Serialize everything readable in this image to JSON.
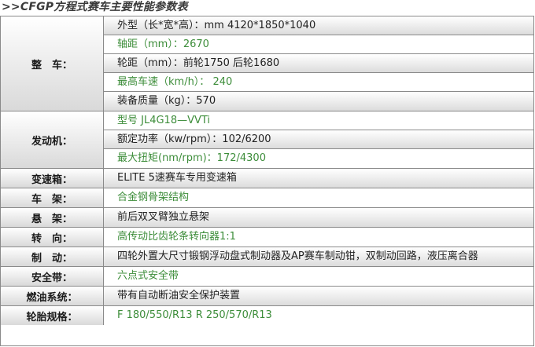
{
  "title": ">>CFGP方程式赛车主要性能参数表",
  "colors": {
    "green_text": "#3d8d3a",
    "dark_text": "#222222",
    "border": "#8a8a8a"
  },
  "groups": [
    {
      "label": "整　车：",
      "values": [
        {
          "text": "外型（长*宽*高）：mm 4120*1850*1040",
          "style": "dark"
        },
        {
          "text": "轴距（mm）：2670",
          "style": "green"
        },
        {
          "text": "轮距（mm）：前轮1750  后轮1680",
          "style": "dark"
        },
        {
          "text": "最高车速（km/h）： 240",
          "style": "green"
        },
        {
          "text": "装备质量（kg）：570",
          "style": "dark"
        }
      ]
    },
    {
      "label": "发动机：",
      "values": [
        {
          "text": "型号 JL4G18—VVTi",
          "style": "green"
        },
        {
          "text": "额定功率（kw/rpm）：102/6200",
          "style": "dark"
        },
        {
          "text": "最大扭矩(nm/rpm)：172/4300",
          "style": "green"
        }
      ]
    },
    {
      "label": "变速箱：",
      "values": [
        {
          "text": "ELITE 5速赛车专用变速箱",
          "style": "dark"
        }
      ]
    },
    {
      "label": "车　架：",
      "values": [
        {
          "text": "合金钢骨架结构",
          "style": "green"
        }
      ]
    },
    {
      "label": "悬　架：",
      "values": [
        {
          "text": "前后双叉臂独立悬架",
          "style": "dark"
        }
      ]
    },
    {
      "label": "转　向：",
      "values": [
        {
          "text": "高传动比齿轮条转向器1:1",
          "style": "green"
        }
      ]
    },
    {
      "label": "制　动：",
      "values": [
        {
          "text": "四轮外置大尺寸锻钢浮动盘式制动器及AP赛车制动钳，双制动回路，液压离合器",
          "style": "dark"
        }
      ]
    },
    {
      "label": "安全带：",
      "values": [
        {
          "text": "六点式安全带",
          "style": "green"
        }
      ]
    },
    {
      "label": "燃油系统：",
      "values": [
        {
          "text": "带有自动断油安全保护装置",
          "style": "dark"
        }
      ]
    },
    {
      "label": "轮胎规格：",
      "values": [
        {
          "text": "F 180/550/R13    R 250/570/R13",
          "style": "green"
        }
      ]
    }
  ]
}
